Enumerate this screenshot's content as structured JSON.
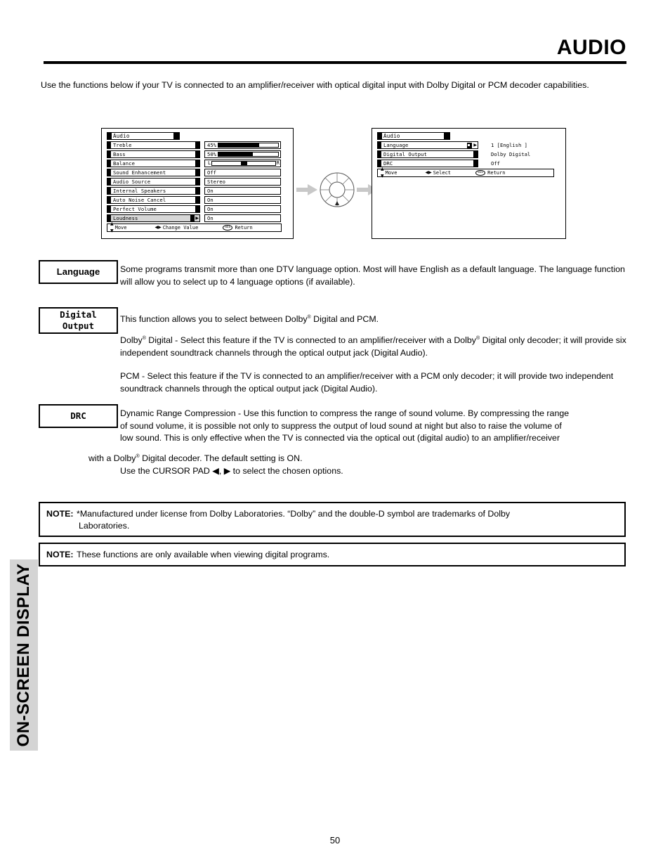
{
  "header": {
    "title": "AUDIO"
  },
  "intro": {
    "text": "Use the functions below if your TV is connected to an amplifier/receiver with optical digital input with Dolby Digital or PCM decoder capabilities."
  },
  "osd_panel_1": {
    "title": "Audio",
    "rows": [
      {
        "label": "Treble",
        "value_type": "bar",
        "value": "45%",
        "fill_pct": 68
      },
      {
        "label": "Bass",
        "value_type": "bar",
        "value": "50%",
        "fill_pct": 58
      },
      {
        "label": "Balance",
        "value_type": "balance",
        "left_letter": "L",
        "right_letter": "R",
        "knob_pct": 50
      },
      {
        "label": "Sound Enhancement",
        "value_type": "text",
        "value": "Off"
      },
      {
        "label": "Audio Source",
        "value_type": "text",
        "value": "Stereo"
      },
      {
        "label": "Internal Speakers",
        "value_type": "text",
        "value": "On"
      },
      {
        "label": "Auto Noise Cancel",
        "value_type": "text",
        "value": "On"
      },
      {
        "label": "Perfect Volume",
        "value_type": "text",
        "value": "On"
      },
      {
        "label": "Loudness",
        "value_type": "text",
        "value": "On",
        "highlighted": true
      }
    ],
    "hint": {
      "move": "Move",
      "change": "Change Value",
      "select_badge": "SEL",
      "return": "Return"
    }
  },
  "osd_panel_2": {
    "title": "Audio",
    "rows": [
      {
        "label": "Language",
        "value": "1 [English ]",
        "highlighted": true
      },
      {
        "label": "Digital Output",
        "value": "Dolby Digital"
      },
      {
        "label": "DRC",
        "value": "Off"
      }
    ],
    "hint": {
      "move": "Move",
      "select": "Select",
      "select_badge": "SEL",
      "return": "Return"
    }
  },
  "sections": {
    "language": {
      "box_label": "Language",
      "text": "Some programs transmit more than one DTV language option.  Most will have English as a default language.  The language function will allow you to select up to 4 language options (if available)."
    },
    "digital_output": {
      "box_label_line1": "Digital",
      "box_label_line2": "Output",
      "text_intro_a": "This function allows you to select between Dolby",
      "text_intro_b": " Digital and PCM.",
      "dolby_para_a": "Dolby",
      "dolby_para_b": " Digital - Select this feature if the TV is connected to an amplifier/receiver with a Dolby",
      "dolby_para_c": " Digital only decoder; it will provide six independent soundtrack channels through the optical output jack (Digital Audio).",
      "pcm_para": "PCM - Select this feature if the TV is connected to an amplifier/receiver with a PCM only decoder; it will provide two independent soundtrack channels through the optical output jack (Digital Audio)."
    },
    "drc": {
      "box_label": "DRC",
      "line1": "Dynamic Range Compression - Use this function to compress the range of sound volume. By compressing the range",
      "line2": "of sound volume, it is possible not only to suppress the output of loud sound at night but also to raise the volume of",
      "line3": "low sound.  This is only effective when the TV is connected via the optical out (digital audio) to an amplifier/receiver",
      "line4_a": "with a Dolby",
      "line4_b": " Digital decoder.  The default setting is ON.",
      "line5_a": "Use the CURSOR PAD ",
      "line5_arrow_left": "◀",
      "line5_mid": ", ",
      "line5_arrow_right": "▶",
      "line5_b": " to select the chosen options."
    }
  },
  "notes": [
    {
      "label": "NOTE:",
      "text": "*Manufactured under license from Dolby Laboratories.  “Dolby” and the double-D symbol are trademarks of Dolby",
      "text_line2": "Laboratories."
    },
    {
      "label": "NOTE:",
      "text": "These functions are only available when viewing digital programs."
    }
  ],
  "side_tab": {
    "label": "ON-SCREEN DISPLAY"
  },
  "footer": {
    "page_number": "50"
  },
  "colors": {
    "side_tab_bg": "#d4d4d4",
    "arrow_gray": "#c8c8c8",
    "highlight": "#d6d6d6"
  }
}
